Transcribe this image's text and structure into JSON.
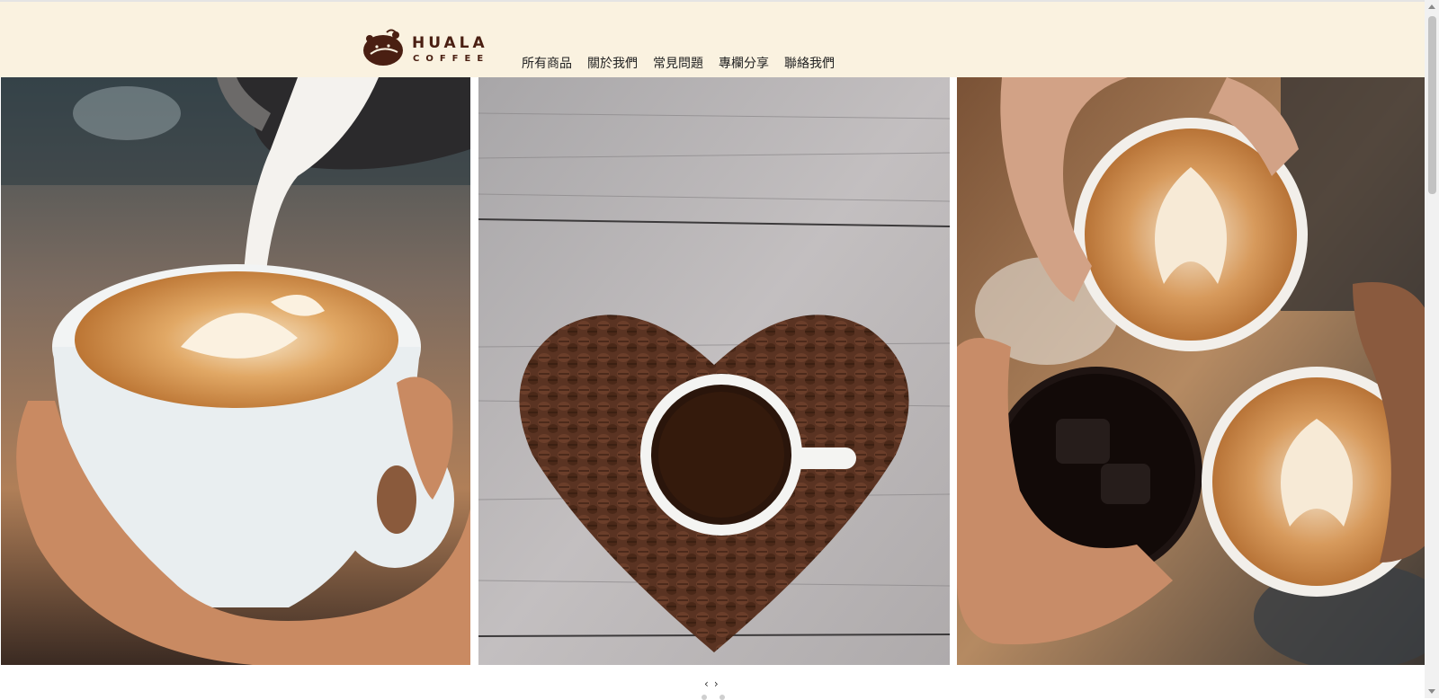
{
  "brand": {
    "name": "HUALA",
    "subtitle": "COFFEE",
    "logo_icon": "coffee-bean-face-icon",
    "color": "#4a1f12"
  },
  "header": {
    "background": "#faf2e0"
  },
  "nav": {
    "items": [
      {
        "label": "所有商品"
      },
      {
        "label": "關於我們"
      },
      {
        "label": "常見問題"
      },
      {
        "label": "專欄分享"
      },
      {
        "label": "聯絡我們"
      }
    ]
  },
  "gallery": {
    "images": [
      {
        "subject": "latte-art-pour-photo"
      },
      {
        "subject": "coffee-beans-heart-photo"
      },
      {
        "subject": "three-cups-cheers-photo"
      }
    ]
  },
  "carousel": {
    "prev_label": "‹",
    "next_label": "›",
    "dot_count": 2
  }
}
